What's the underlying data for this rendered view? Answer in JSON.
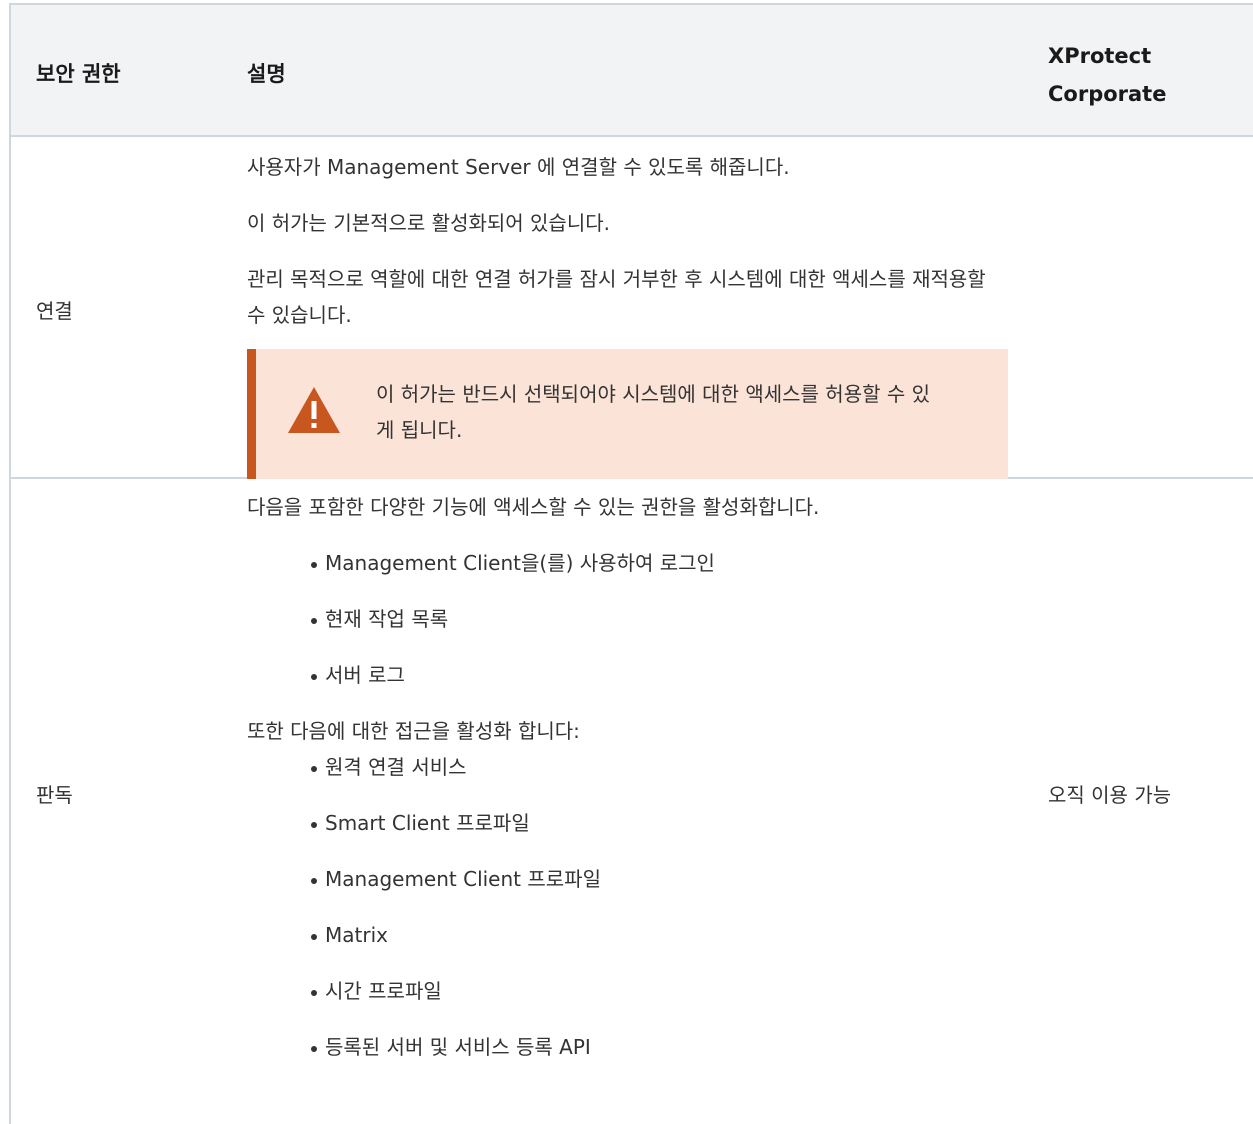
{
  "table": {
    "headers": {
      "permission": "보안 권한",
      "description": "설명",
      "product_line1": "XProtect",
      "product_line2": "Corporate"
    },
    "rows": [
      {
        "name": "연결",
        "paragraphs": [
          "사용자가 Management Server 에 연결할 수 있도록 해줍니다.",
          "이 허가는 기본적으로 활성화되어 있습니다.",
          "관리 목적으로 역할에 대한 연결 허가를 잠시 거부한 후 시스템에 대한 액세스를 재적용할 수 있습니다."
        ],
        "warning": {
          "icon": "warning-triangle-icon",
          "text": "이 허가는 반드시 선택되어야 시스템에 대한 액세스를 허용할 수 있게 됩니다."
        },
        "availability": ""
      },
      {
        "name": "판독",
        "intro": "다음을 포함한 다양한 기능에 액세스할 수 있는 권한을 활성화합니다.",
        "list1": [
          "Management Client을(를) 사용하여 로그인",
          "현재 작업 목록",
          "서버 로그"
        ],
        "mid": "또한 다음에 대한 접근을 활성화 합니다:",
        "list2": [
          "원격 연결 서비스",
          "Smart Client 프로파일",
          "Management Client 프로파일",
          "Matrix",
          "시간 프로파일",
          "등록된 서버 및 서비스 등록 API"
        ],
        "availability": "오직 이용 가능"
      }
    ]
  },
  "colors": {
    "warning_accent": "#c7561f",
    "warning_background": "#fbe3d8",
    "header_background": "#f2f3f4",
    "border": "#cfd6dc"
  }
}
